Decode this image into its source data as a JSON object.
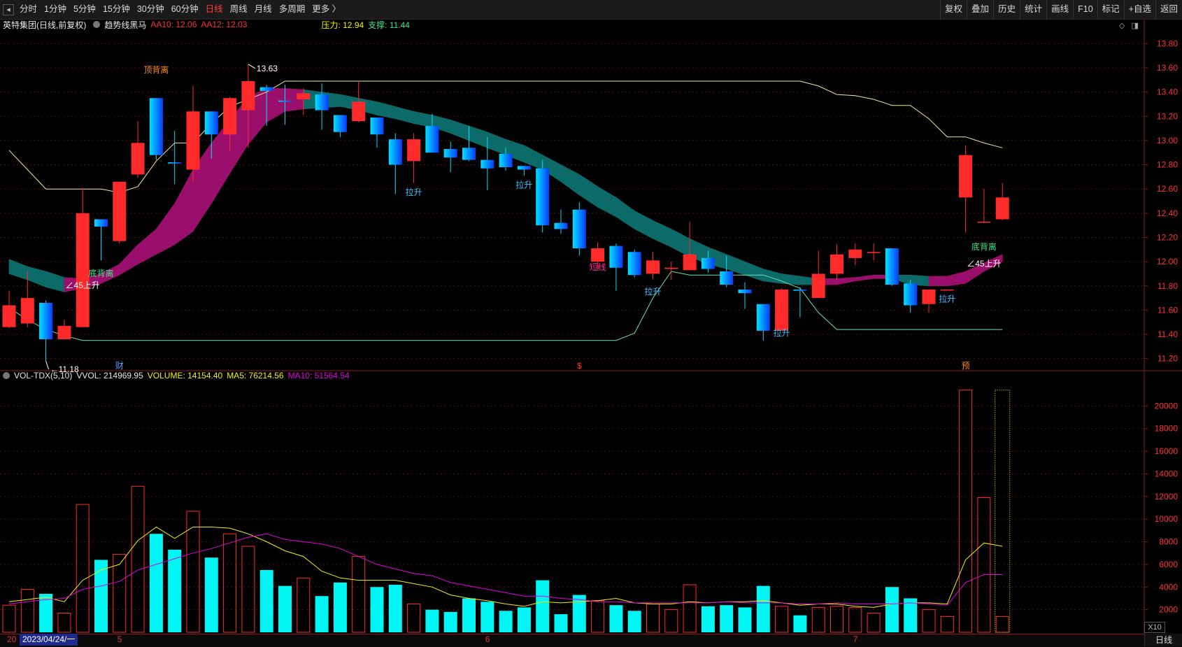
{
  "toolbar": {
    "left_items": [
      "分时",
      "1分钟",
      "5分钟",
      "15分钟",
      "30分钟",
      "60分钟",
      "日线",
      "周线",
      "月线",
      "多周期",
      "更多 〉"
    ],
    "active_item": "日线",
    "right_items": [
      "复权",
      "叠加",
      "历史",
      "统计",
      "画线",
      "F10",
      "标记",
      "+自选",
      "返回"
    ]
  },
  "main_legend": {
    "stock_name": "英特集团(日线,前复权)",
    "indicator": "趋势线黑马",
    "aa10": "AA10: 12.06",
    "aa12": "AA12: 12.03",
    "pressure": "压力: 12.94",
    "support": "支撑: 11.44"
  },
  "vol_legend": {
    "name": "VOL-TDX(5,10)",
    "vvol": "VVOL: 214969.95",
    "volume": "VOLUME: 14154.40",
    "ma5": "MA5: 76214.56",
    "ma10": "MA10: 51564.54"
  },
  "colors": {
    "up": "#ff2a2a",
    "down_start": "#00e0ff",
    "down_end": "#0a3cff",
    "band_up": "#9a0f6b",
    "band_down": "#0c6b69",
    "pressure_line": "#f0eb9c",
    "support_line": "#6fe3b0",
    "vol_down": "#00f5f5",
    "ma5": "#f2f200",
    "ma10": "#e000e0",
    "grid": "#5a0e0e"
  },
  "chart_data": {
    "type": "candlestick",
    "price_axis": {
      "min": 11.1,
      "max": 13.9,
      "ticks": [
        "13.80",
        "13.60",
        "13.40",
        "13.20",
        "13.00",
        "12.80",
        "12.60",
        "12.40",
        "12.20",
        "12.00",
        "11.80",
        "11.60",
        "11.40",
        "11.20"
      ]
    },
    "volume_axis": {
      "min": 0,
      "max": 22000,
      "ticks": [
        "20000",
        "18000",
        "16000",
        "14000",
        "12000",
        "10000",
        "8000",
        "6000",
        "4000",
        "2000"
      ]
    },
    "candles": [
      {
        "o": 11.46,
        "h": 11.76,
        "l": 11.45,
        "c": 11.64
      },
      {
        "o": 11.49,
        "h": 11.92,
        "l": 11.46,
        "c": 11.7
      },
      {
        "o": 11.66,
        "h": 11.68,
        "l": 11.18,
        "c": 11.36
      },
      {
        "o": 11.36,
        "h": 11.52,
        "l": 11.36,
        "c": 11.47
      },
      {
        "o": 11.46,
        "h": 12.61,
        "l": 11.46,
        "c": 12.4
      },
      {
        "o": 12.35,
        "h": 12.35,
        "l": 12.01,
        "c": 12.29
      },
      {
        "o": 12.17,
        "h": 12.66,
        "l": 12.15,
        "c": 12.66
      },
      {
        "o": 12.72,
        "h": 13.16,
        "l": 12.69,
        "c": 12.98
      },
      {
        "o": 13.35,
        "h": 13.35,
        "l": 12.84,
        "c": 12.88
      },
      {
        "o": 12.82,
        "h": 13.08,
        "l": 12.64,
        "c": 12.81
      },
      {
        "o": 12.76,
        "h": 13.45,
        "l": 12.66,
        "c": 13.24
      },
      {
        "o": 13.24,
        "h": 13.24,
        "l": 12.85,
        "c": 13.05
      },
      {
        "o": 13.05,
        "h": 13.36,
        "l": 12.91,
        "c": 13.35
      },
      {
        "o": 13.25,
        "h": 13.63,
        "l": 12.94,
        "c": 13.49
      },
      {
        "o": 13.44,
        "h": 13.46,
        "l": 13.12,
        "c": 13.41
      },
      {
        "o": 13.33,
        "h": 13.46,
        "l": 13.13,
        "c": 13.32
      },
      {
        "o": 13.34,
        "h": 13.43,
        "l": 13.21,
        "c": 13.39
      },
      {
        "o": 13.38,
        "h": 13.47,
        "l": 13.09,
        "c": 13.25
      },
      {
        "o": 13.21,
        "h": 13.21,
        "l": 13.03,
        "c": 13.07
      },
      {
        "o": 13.16,
        "h": 13.49,
        "l": 13.15,
        "c": 13.32
      },
      {
        "o": 13.19,
        "h": 13.19,
        "l": 12.94,
        "c": 13.05
      },
      {
        "o": 13.01,
        "h": 13.06,
        "l": 12.56,
        "c": 12.8
      },
      {
        "o": 12.83,
        "h": 13.06,
        "l": 12.65,
        "c": 13.01
      },
      {
        "o": 13.12,
        "h": 13.22,
        "l": 12.93,
        "c": 12.9
      },
      {
        "o": 12.93,
        "h": 12.99,
        "l": 12.74,
        "c": 12.86
      },
      {
        "o": 12.94,
        "h": 13.12,
        "l": 12.83,
        "c": 12.84
      },
      {
        "o": 12.84,
        "h": 13.03,
        "l": 12.59,
        "c": 12.77
      },
      {
        "o": 12.89,
        "h": 12.94,
        "l": 12.75,
        "c": 12.78
      },
      {
        "o": 12.79,
        "h": 12.79,
        "l": 12.71,
        "c": 12.76
      },
      {
        "o": 12.77,
        "h": 12.84,
        "l": 12.24,
        "c": 12.3
      },
      {
        "o": 12.32,
        "h": 12.43,
        "l": 12.23,
        "c": 12.27
      },
      {
        "o": 12.43,
        "h": 12.49,
        "l": 12.05,
        "c": 12.11
      },
      {
        "o": 12.0,
        "h": 12.16,
        "l": 11.93,
        "c": 12.11
      },
      {
        "o": 12.13,
        "h": 12.15,
        "l": 11.76,
        "c": 11.95
      },
      {
        "o": 12.08,
        "h": 12.1,
        "l": 11.87,
        "c": 11.89
      },
      {
        "o": 11.9,
        "h": 12.08,
        "l": 11.86,
        "c": 12.01
      },
      {
        "o": 11.94,
        "h": 12.0,
        "l": 11.85,
        "c": 11.95
      },
      {
        "o": 11.93,
        "h": 12.33,
        "l": 11.93,
        "c": 12.06
      },
      {
        "o": 12.03,
        "h": 12.09,
        "l": 11.91,
        "c": 11.94
      },
      {
        "o": 11.92,
        "h": 12.05,
        "l": 11.79,
        "c": 11.81
      },
      {
        "o": 11.77,
        "h": 11.83,
        "l": 11.61,
        "c": 11.74
      },
      {
        "o": 11.65,
        "h": 11.65,
        "l": 11.35,
        "c": 11.43
      },
      {
        "o": 11.43,
        "h": 11.78,
        "l": 11.43,
        "c": 11.77
      },
      {
        "o": 11.77,
        "h": 11.79,
        "l": 11.54,
        "c": 11.76
      },
      {
        "o": 11.7,
        "h": 12.09,
        "l": 11.7,
        "c": 11.9
      },
      {
        "o": 11.9,
        "h": 12.14,
        "l": 11.85,
        "c": 12.06
      },
      {
        "o": 12.03,
        "h": 12.15,
        "l": 11.97,
        "c": 12.1
      },
      {
        "o": 12.08,
        "h": 12.15,
        "l": 12.01,
        "c": 12.08
      },
      {
        "o": 12.11,
        "h": 12.11,
        "l": 11.8,
        "c": 11.81
      },
      {
        "o": 11.82,
        "h": 11.85,
        "l": 11.58,
        "c": 11.64
      },
      {
        "o": 11.65,
        "h": 11.76,
        "l": 11.58,
        "c": 11.77
      },
      {
        "o": 11.77,
        "h": 11.77,
        "l": 11.77,
        "c": 11.77
      },
      {
        "o": 12.53,
        "h": 12.96,
        "l": 12.24,
        "c": 12.88
      },
      {
        "o": 12.33,
        "h": 12.6,
        "l": 12.32,
        "c": 12.33
      },
      {
        "o": 12.35,
        "h": 12.65,
        "l": 12.34,
        "c": 12.53
      }
    ],
    "volumes": [
      2400,
      3800,
      3400,
      1700,
      11300,
      6400,
      6900,
      12900,
      8700,
      7300,
      10700,
      6600,
      8700,
      7600,
      5500,
      4100,
      4800,
      3200,
      4400,
      6700,
      4000,
      4200,
      2500,
      2000,
      1800,
      3000,
      2700,
      1900,
      2200,
      4600,
      1600,
      3300,
      2800,
      2400,
      1900,
      2500,
      2000,
      4200,
      2300,
      2400,
      2200,
      4100,
      2300,
      1500,
      2200,
      2300,
      2200,
      1700,
      4000,
      3000,
      2000,
      1400,
      21400,
      11900,
      1400
    ],
    "pressure_line": [
      12.92,
      12.76,
      12.6,
      12.6,
      12.6,
      12.6,
      12.57,
      12.62,
      12.83,
      12.98,
      12.98,
      13.14,
      13.28,
      13.34,
      13.4,
      13.49,
      13.49,
      13.49,
      13.49,
      13.49,
      13.49,
      13.49,
      13.49,
      13.49,
      13.49,
      13.49,
      13.49,
      13.49,
      13.49,
      13.49,
      13.49,
      13.49,
      13.49,
      13.49,
      13.49,
      13.49,
      13.49,
      13.49,
      13.49,
      13.49,
      13.49,
      13.49,
      13.49,
      13.49,
      13.45,
      13.38,
      13.37,
      13.34,
      13.29,
      13.29,
      13.18,
      13.03,
      13.03,
      12.98,
      12.94
    ],
    "support_line": [
      11.62,
      11.52,
      11.44,
      11.39,
      11.35,
      11.35,
      11.35,
      11.35,
      11.35,
      11.35,
      11.35,
      11.35,
      11.35,
      11.35,
      11.35,
      11.35,
      11.35,
      11.35,
      11.35,
      11.35,
      11.35,
      11.35,
      11.35,
      11.35,
      11.35,
      11.35,
      11.35,
      11.35,
      11.35,
      11.35,
      11.35,
      11.35,
      11.35,
      11.35,
      11.41,
      11.7,
      11.92,
      11.89,
      11.89,
      11.89,
      11.89,
      11.89,
      11.84,
      11.78,
      11.58,
      11.44,
      11.44,
      11.44,
      11.44,
      11.44,
      11.44,
      11.44,
      11.44,
      11.44,
      11.44
    ],
    "band_upper": [
      12.02,
      11.96,
      11.92,
      11.87,
      11.86,
      11.9,
      11.98,
      12.14,
      12.27,
      12.48,
      12.76,
      12.98,
      13.17,
      13.36,
      13.43,
      13.43,
      13.42,
      13.4,
      13.38,
      13.35,
      13.32,
      13.28,
      13.24,
      13.21,
      13.17,
      13.12,
      13.07,
      13.01,
      12.96,
      12.88,
      12.8,
      12.72,
      12.62,
      12.53,
      12.42,
      12.34,
      12.27,
      12.19,
      12.12,
      12.06,
      12.0,
      11.94,
      11.9,
      11.88,
      11.86,
      11.86,
      11.87,
      11.89,
      11.89,
      11.89,
      11.88,
      11.88,
      11.92,
      11.99,
      12.06
    ],
    "band_lower": [
      11.9,
      11.85,
      11.79,
      11.75,
      11.78,
      11.82,
      11.89,
      11.98,
      12.06,
      12.14,
      12.25,
      12.48,
      12.73,
      12.97,
      13.15,
      13.24,
      13.26,
      13.27,
      13.28,
      13.25,
      13.21,
      13.18,
      13.14,
      13.11,
      13.06,
      13.0,
      12.94,
      12.88,
      12.82,
      12.76,
      12.66,
      12.55,
      12.45,
      12.37,
      12.27,
      12.19,
      12.12,
      12.04,
      11.98,
      11.94,
      11.89,
      11.84,
      11.82,
      11.81,
      11.81,
      11.81,
      11.84,
      11.86,
      11.86,
      11.81,
      11.8,
      11.8,
      11.82,
      11.92,
      12.0
    ],
    "vol_ma5": [
      2700,
      2900,
      3100,
      2700,
      4600,
      5500,
      6000,
      8100,
      9300,
      8300,
      9300,
      9300,
      9200,
      8700,
      8000,
      7200,
      6700,
      5400,
      4800,
      4600,
      4600,
      4600,
      4300,
      4000,
      3300,
      3000,
      2800,
      2500,
      2300,
      2700,
      2600,
      2700,
      2800,
      3000,
      2600,
      2500,
      2500,
      2700,
      2600,
      2700,
      2700,
      2800,
      2600,
      2400,
      2500,
      2500,
      2300,
      2200,
      2500,
      2600,
      2600,
      2500,
      6400,
      7900,
      7600
    ],
    "vol_ma10": [
      2500,
      2700,
      2900,
      3000,
      3800,
      4100,
      4500,
      5500,
      6000,
      6500,
      7000,
      7400,
      7900,
      8400,
      8700,
      8200,
      8000,
      7800,
      7400,
      6700,
      6000,
      5600,
      5200,
      5000,
      4400,
      4100,
      3800,
      3500,
      3200,
      3200,
      3000,
      2900,
      2700,
      2700,
      2600,
      2600,
      2600,
      2600,
      2600,
      2700,
      2600,
      2600,
      2600,
      2500,
      2500,
      2600,
      2500,
      2500,
      2500,
      2600,
      2500,
      2400,
      4400,
      5100,
      5100
    ],
    "annotations": [
      {
        "text": "顶背离",
        "i": 8,
        "price": 13.56,
        "color": "#ff8c1a"
      },
      {
        "text": "底背离",
        "i": 5,
        "price": 11.88,
        "color": "#3fe28a"
      },
      {
        "text": "∠45上升",
        "i": 4,
        "price": 11.78,
        "color": "#ffffff"
      },
      {
        "text": "拉升",
        "i": 22,
        "price": 12.55,
        "color": "#39c3ff"
      },
      {
        "text": "拉升",
        "i": 28,
        "price": 12.61,
        "color": "#39c3ff"
      },
      {
        "text": "拉升",
        "i": 35,
        "price": 11.73,
        "color": "#39c3ff"
      },
      {
        "text": "拉升",
        "i": 42,
        "price": 11.39,
        "color": "#39c3ff"
      },
      {
        "text": "拉升",
        "i": 51,
        "price": 11.67,
        "color": "#39c3ff"
      },
      {
        "text": "短线",
        "i": 32,
        "price": 11.93,
        "color": "#ff2aa0"
      },
      {
        "text": "底背离",
        "i": 53,
        "price": 12.1,
        "color": "#3fe28a"
      },
      {
        "text": "∠45上升",
        "i": 53,
        "price": 11.96,
        "color": "#ffffff"
      }
    ],
    "high_label": "13.63",
    "low_label": "11.18",
    "event_markers": [
      {
        "text": "财",
        "i": 6,
        "color": "#5aa0ff"
      },
      {
        "text": "$",
        "i": 31,
        "color": "#ff3030"
      },
      {
        "text": "预",
        "i": 52,
        "color": "#ff8c1a"
      }
    ]
  },
  "x_axis": {
    "pre_label": "20",
    "date_label": "2023/04/24/一",
    "month_ticks": [
      {
        "text": "5",
        "i": 6
      },
      {
        "text": "6",
        "i": 26
      },
      {
        "text": "7",
        "i": 46
      }
    ]
  },
  "period_tab": "日线",
  "x10_label": "X10"
}
